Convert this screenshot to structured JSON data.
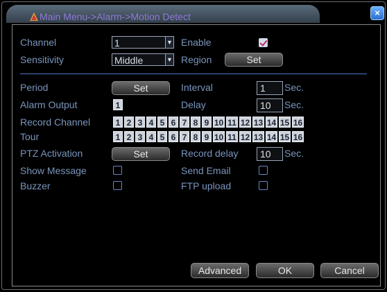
{
  "window": {
    "title": "Main Menu->Alarm->Motion Detect",
    "close_label": "×"
  },
  "colors": {
    "label": "#7a95bd",
    "title": "#8e7bd6",
    "accent_line": "#4a78c6",
    "checkbox_check": "#b0306a"
  },
  "channel": {
    "label": "Channel",
    "value": "1"
  },
  "enable": {
    "label": "Enable",
    "checked": true
  },
  "sensitivity": {
    "label": "Sensitivity",
    "value": "Middle"
  },
  "region": {
    "label": "Region",
    "button": "Set"
  },
  "period": {
    "label": "Period",
    "button": "Set"
  },
  "interval": {
    "label": "Interval",
    "value": "1",
    "unit": "Sec."
  },
  "alarm_output": {
    "label": "Alarm Output",
    "value": "1"
  },
  "delay": {
    "label": "Delay",
    "value": "10",
    "unit": "Sec."
  },
  "record_channel": {
    "label": "Record Channel",
    "channels": [
      "1",
      "2",
      "3",
      "4",
      "5",
      "6",
      "7",
      "8",
      "9",
      "10",
      "11",
      "12",
      "13",
      "14",
      "15",
      "16"
    ]
  },
  "tour": {
    "label": "Tour",
    "channels": [
      "1",
      "2",
      "3",
      "4",
      "5",
      "6",
      "7",
      "8",
      "9",
      "10",
      "11",
      "12",
      "13",
      "14",
      "15",
      "16"
    ]
  },
  "ptz_activation": {
    "label": "PTZ Activation",
    "button": "Set"
  },
  "record_delay": {
    "label": "Record delay",
    "value": "10",
    "unit": "Sec."
  },
  "show_message": {
    "label": "Show Message",
    "checked": false
  },
  "send_email": {
    "label": "Send Email",
    "checked": false
  },
  "buzzer": {
    "label": "Buzzer",
    "checked": false
  },
  "ftp_upload": {
    "label": "FTP upload",
    "checked": false
  },
  "footer": {
    "advanced": "Advanced",
    "ok": "OK",
    "cancel": "Cancel"
  }
}
